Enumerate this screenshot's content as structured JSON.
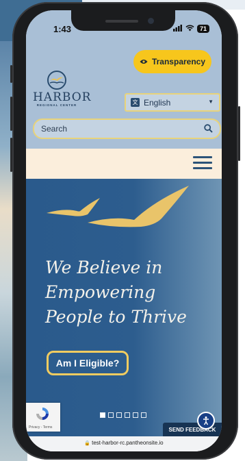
{
  "status_bar": {
    "time": "1:43",
    "battery": "71"
  },
  "header": {
    "logo_name": "HARBOR",
    "logo_subtitle": "REGIONAL CENTER",
    "transparency_label": "Transparency",
    "language": {
      "selected": "English"
    },
    "search": {
      "placeholder": "Search"
    }
  },
  "hero": {
    "title": "We Believe in Empowering People to Thrive",
    "button_label": "Am I Eligible?",
    "slides": [
      true,
      false,
      false,
      false,
      false,
      false
    ]
  },
  "recaptcha": {
    "footer": "Privacy - Terms"
  },
  "feedback_label": "SEND FEEDBACK",
  "browser": {
    "url": "test-harbor-rc.pantheonsite.io"
  },
  "colors": {
    "accent_yellow": "#f7c61c",
    "header_blue": "#a9bfd6",
    "hero_blue": "#2d5d8e",
    "cream": "#fbeedc"
  }
}
